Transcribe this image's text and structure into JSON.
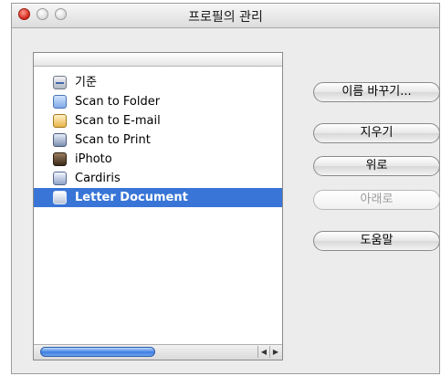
{
  "window": {
    "title": "프로필의 관리"
  },
  "profiles": {
    "items": [
      {
        "label": "기준",
        "icon": "scanner-icon",
        "selected": false
      },
      {
        "label": "Scan to Folder",
        "icon": "folder-icon",
        "selected": false
      },
      {
        "label": "Scan to E-mail",
        "icon": "mail-icon",
        "selected": false
      },
      {
        "label": "Scan to Print",
        "icon": "printer-icon",
        "selected": false
      },
      {
        "label": "iPhoto",
        "icon": "iphoto-icon",
        "selected": false
      },
      {
        "label": "Cardiris",
        "icon": "cardiris-icon",
        "selected": false
      },
      {
        "label": "Letter Document",
        "icon": "scanner-icon",
        "selected": true
      }
    ],
    "selection_color": "#3875d7"
  },
  "buttons": {
    "rename": "이름 바꾸기...",
    "delete": "지우기",
    "up": "위로",
    "down": "아래로",
    "help": "도움말"
  },
  "scrollbar": {
    "left_arrow": "◀",
    "right_arrow": "▶"
  }
}
